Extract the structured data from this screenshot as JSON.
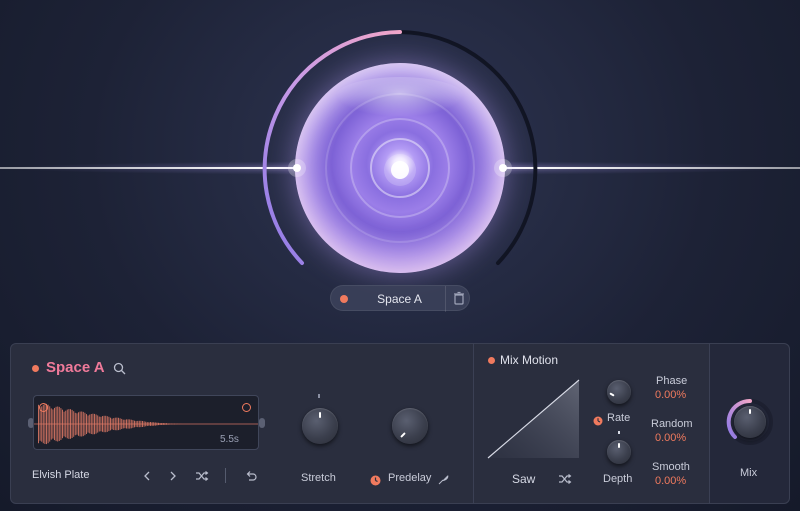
{
  "visual": {
    "space_name": "Space A"
  },
  "panel": {
    "space_title": "Space A",
    "preset_name": "Elvish Plate",
    "duration": "5.5s",
    "stretch_label": "Stretch",
    "predelay_label": "Predelay",
    "mix_label": "Mix"
  },
  "mix_motion": {
    "title": "Mix Motion",
    "shape": "Saw",
    "rate_label": "Rate",
    "depth_label": "Depth",
    "phase": {
      "label": "Phase",
      "value": "0.00%"
    },
    "random": {
      "label": "Random",
      "value": "0.00%"
    },
    "smooth": {
      "label": "Smooth",
      "value": "0.00%"
    }
  },
  "icons": {
    "search": "search-icon",
    "prev": "chevron-left-icon",
    "next": "chevron-right-icon",
    "shuffle": "shuffle-icon",
    "undo": "undo-icon",
    "trash": "trash-icon",
    "feather": "feather-icon",
    "timer": "timer-icon"
  },
  "colors": {
    "accent": "#f07a5e",
    "title_pink": "#f07a9a",
    "arc_left": "#c9a0ff",
    "arc_top": "#e39bc7",
    "panel_bg": "#2a2e3e"
  }
}
